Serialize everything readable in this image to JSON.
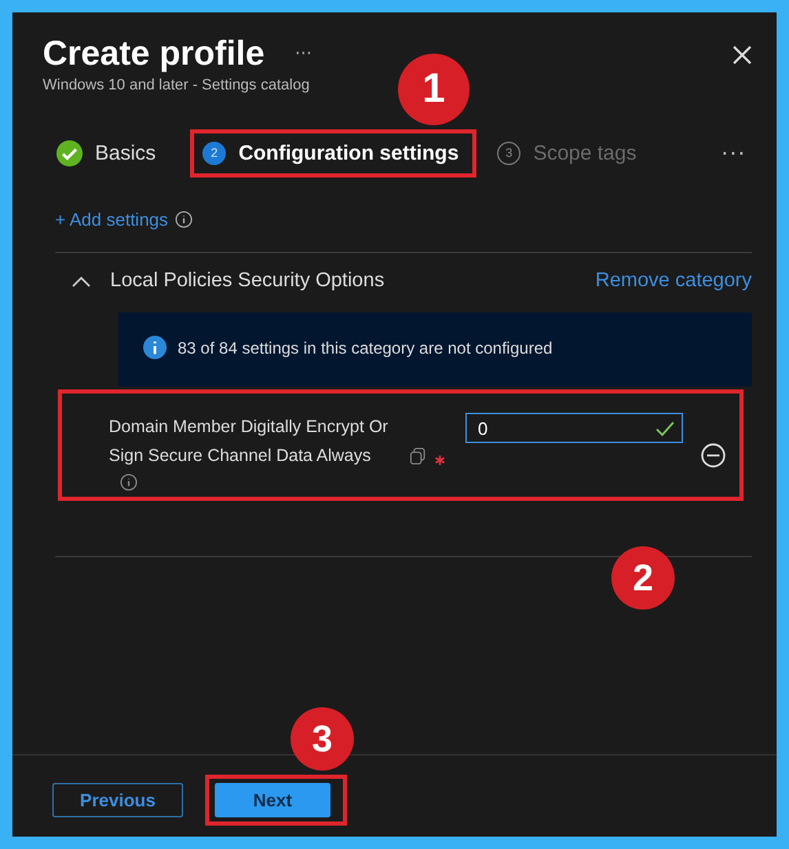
{
  "header": {
    "title": "Create profile",
    "more": "···",
    "subtitle": "Windows 10 and later - Settings catalog"
  },
  "steps": [
    {
      "label": "Basics",
      "completed": true,
      "selected": false,
      "highlighted": false
    },
    {
      "number": "2",
      "label": "Configuration settings",
      "completed": false,
      "selected": true,
      "highlighted": true
    },
    {
      "number": "3",
      "label": "Scope tags",
      "completed": false,
      "selected": false,
      "highlighted": false
    }
  ],
  "steps_more": "···",
  "add_settings": "+ Add settings",
  "category": {
    "title": "Local Policies Security Options",
    "expanded": true,
    "remove": "Remove category",
    "info": "83 of 84 settings in this category are not configured"
  },
  "setting": {
    "label": "Domain Member Digitally Encrypt Or Sign Secure Channel Data Always",
    "required": true,
    "value": "0",
    "valid": true,
    "highlighted": true
  },
  "footer": {
    "buttons": [
      {
        "label": "Previous",
        "kind": "secondary",
        "highlighted": false
      },
      {
        "label": "Next",
        "kind": "primary",
        "highlighted": true
      }
    ]
  },
  "callouts": [
    "1",
    "2",
    "3"
  ]
}
